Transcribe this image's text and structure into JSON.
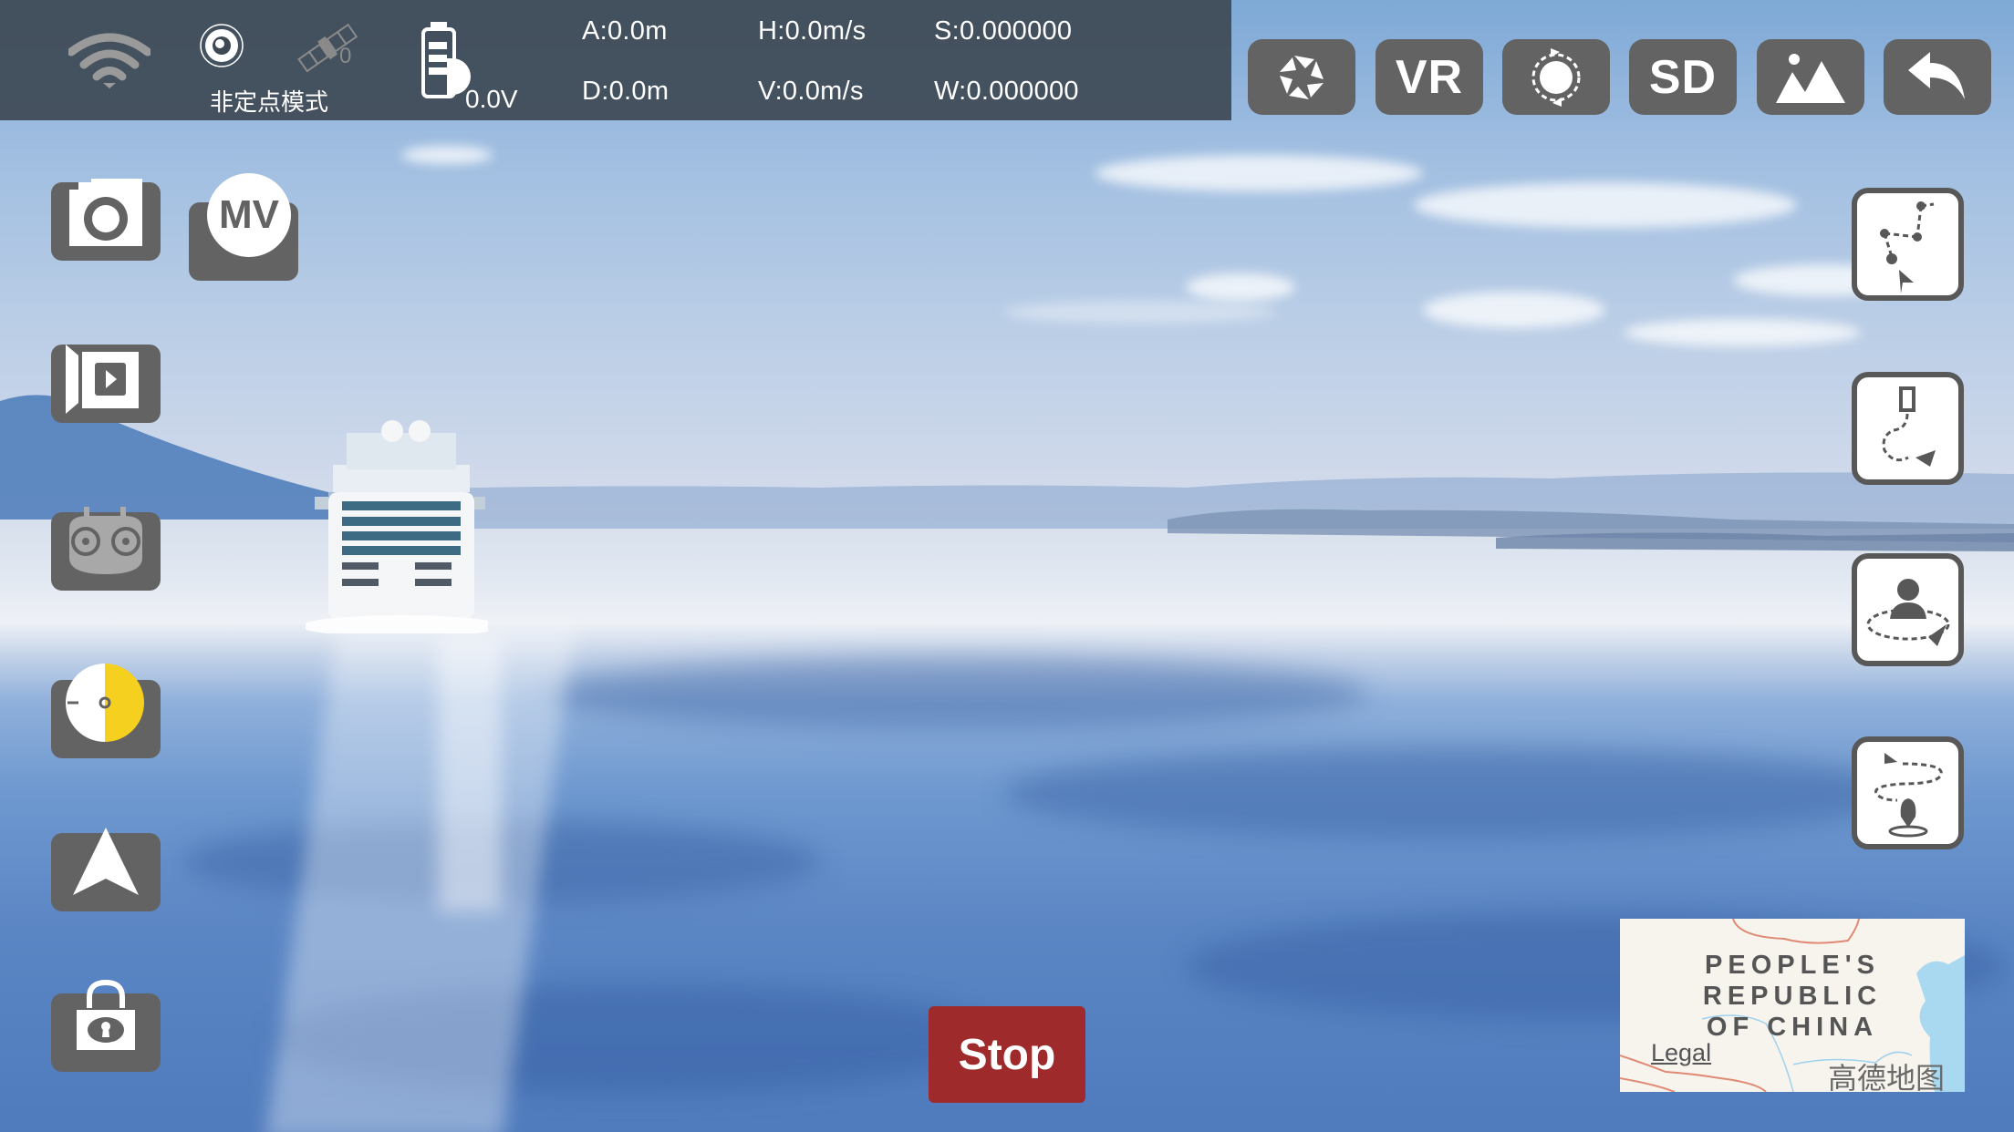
{
  "status_bar": {
    "wifi_icon": "wifi-icon",
    "gps_mode_icon": "gps-mode-icon",
    "satellite_icon": "satellite-icon",
    "satellite_count": "0",
    "flight_mode_label": "非定点模式",
    "battery_icon": "battery-icon",
    "battery_voltage": "0.0V",
    "telemetry": {
      "altitude": "A:0.0m",
      "distance": "D:0.0m",
      "horizontal_speed": "H:0.0m/s",
      "vertical_speed": "V:0.0m/s",
      "latitude": "S:0.000000",
      "longitude": "W:0.000000"
    }
  },
  "top_toolbar": [
    {
      "name": "camera-settings-button",
      "icon": "aperture-icon",
      "label": ""
    },
    {
      "name": "vr-button",
      "icon": "",
      "label": "VR"
    },
    {
      "name": "rotate-camera-button",
      "icon": "rotate-icon",
      "label": ""
    },
    {
      "name": "sd-card-button",
      "icon": "",
      "label": "SD"
    },
    {
      "name": "gallery-button",
      "icon": "image-icon",
      "label": ""
    },
    {
      "name": "back-button",
      "icon": "back-arrow-icon",
      "label": ""
    }
  ],
  "left_toolbar": {
    "photo": "camera-icon",
    "mv": "MV",
    "video": "video-record-icon",
    "remote_controller": "controller-icon",
    "gimbal": "gimbal-dial-icon",
    "takeoff": "navigation-arrow-icon",
    "lock": "lock-icon"
  },
  "right_toolbar": [
    {
      "name": "waypoint-mode-button",
      "icon": "waypoint-path-icon"
    },
    {
      "name": "follow-phone-mode-button",
      "icon": "phone-follow-icon"
    },
    {
      "name": "orbit-mode-button",
      "icon": "orbit-person-icon"
    },
    {
      "name": "spiral-mode-button",
      "icon": "spiral-pin-icon"
    }
  ],
  "stop_button": {
    "label": "Stop",
    "color": "#9e2a2b"
  },
  "minimap": {
    "region_label_lines": [
      "PEOPLE'S",
      "REPUBLIC",
      "OF CHINA"
    ],
    "legal_link": "Legal",
    "provider": "高德地图"
  }
}
